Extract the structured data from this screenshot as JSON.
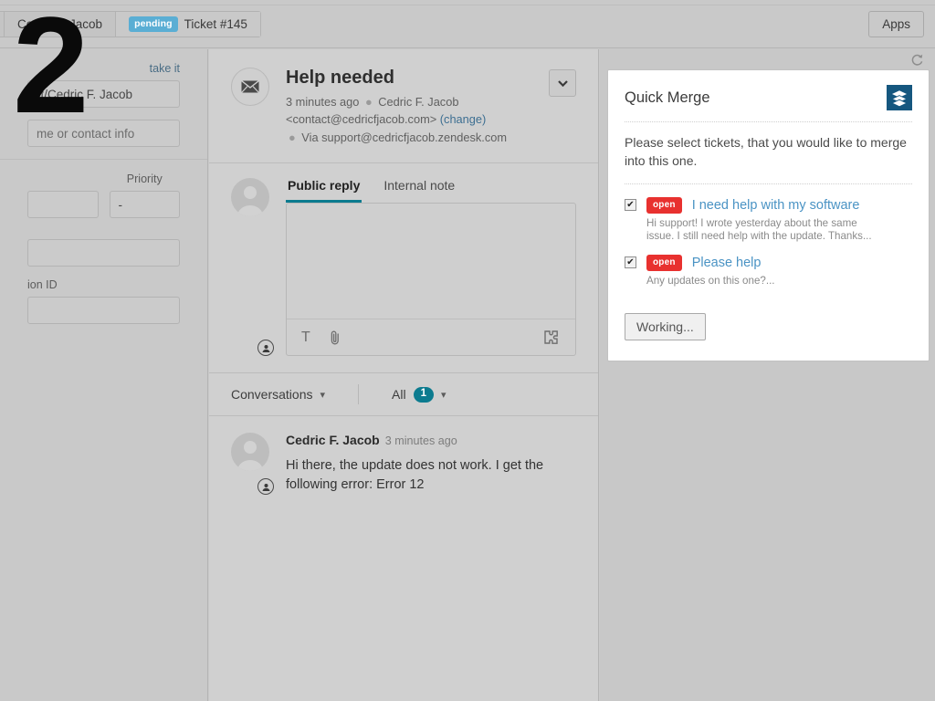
{
  "window": {
    "apps_button": "Apps",
    "refresh_icon": "refresh-icon"
  },
  "tabs": [
    {
      "label": "ob",
      "status": "",
      "truncated": true
    },
    {
      "label": "Cedric F. Jacob",
      "status": ""
    },
    {
      "label": "Ticket #145",
      "status": "pending",
      "active": true
    }
  ],
  "left_pane": {
    "take_it": "take it",
    "assignee_value": "rt/Cedric F. Jacob",
    "requester_placeholder": "me or contact info",
    "priority_label": "Priority",
    "priority_value": "-",
    "transaction_label": "ion ID"
  },
  "ticket": {
    "title": "Help needed",
    "time": "3 minutes ago",
    "requester": "Cedric F. Jacob",
    "email": "<contact@cedricfjacob.com>",
    "change_link": "(change)",
    "via": "Via support@cedricfjacob.zendesk.com",
    "channel_icon": "envelope-icon",
    "dropdown_icon": "chevron-down-icon"
  },
  "composer": {
    "tabs": [
      {
        "label": "Public reply",
        "active": true
      },
      {
        "label": "Internal note",
        "active": false
      }
    ],
    "value": "",
    "tools": [
      {
        "name": "text-format-icon",
        "glyph": "T"
      },
      {
        "name": "attachment-icon",
        "glyph": "paperclip"
      },
      {
        "name": "apps-puzzle-icon",
        "glyph": "puzzle"
      }
    ]
  },
  "conversations_bar": {
    "filter_label": "Conversations",
    "scope_label": "All",
    "count": "1",
    "caret_icon": "chevron-down-icon"
  },
  "conversation": [
    {
      "author": "Cedric F. Jacob",
      "time": "3 minutes ago",
      "body": "Hi there, the update does not work. I get the following error: Error 12"
    }
  ],
  "quick_merge": {
    "title": "Quick Merge",
    "icon": "layers-stack-icon",
    "description": "Please select tickets, that you would like to merge into this one.",
    "tickets": [
      {
        "checked": true,
        "status": "open",
        "title": "I need help with my software",
        "snippet": "Hi support! I wrote yesterday about the same issue. I still need help with the update. Thanks..."
      },
      {
        "checked": true,
        "status": "open",
        "title": "Please help",
        "snippet": "Any updates on this one?..."
      }
    ],
    "submit_label": "Working..."
  },
  "annotation": {
    "step_number": "2"
  },
  "colors": {
    "accent_teal": "#0c7b8f",
    "status_open_red": "#e8312f",
    "status_pending_blue": "#5aaed4",
    "link_blue": "#4a93c4",
    "app_icon_bg": "#15577f"
  }
}
